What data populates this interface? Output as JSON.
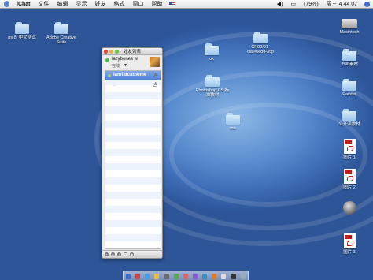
{
  "menubar": {
    "app": "iChat",
    "menus": [
      "文件",
      "编辑",
      "显示",
      "好友",
      "格式",
      "窗口",
      "帮助"
    ],
    "battery": "(79%)",
    "clock": "周三 4 44 07"
  },
  "desktop_icons_left": [
    {
      "label": "ps 8. 中文测试"
    },
    {
      "label": "Adobe Creative Suite"
    }
  ],
  "desktop_icons_center": [
    {
      "label": "ok"
    },
    {
      "label": "CH02/01-clai#6edit-35p"
    },
    {
      "label": "Photoshop CS 标准教材"
    },
    {
      "label": "ina"
    }
  ],
  "desktop_icons_right": [
    {
      "label": "Macintosh"
    },
    {
      "label": "书面素材"
    },
    {
      "label": "Painter"
    },
    {
      "label": "公开演教材"
    },
    {
      "label": "图片 1"
    },
    {
      "label": "图片 2"
    },
    {
      "label": ""
    },
    {
      "label": "图片 3"
    }
  ],
  "buddy_list": {
    "title": "好友列表",
    "my_name": "lazybones w",
    "my_status": "在线",
    "buddies": [
      {
        "name": "iamfatcathome",
        "selected": true
      },
      {
        "name": "...",
        "selected": false
      }
    ]
  }
}
